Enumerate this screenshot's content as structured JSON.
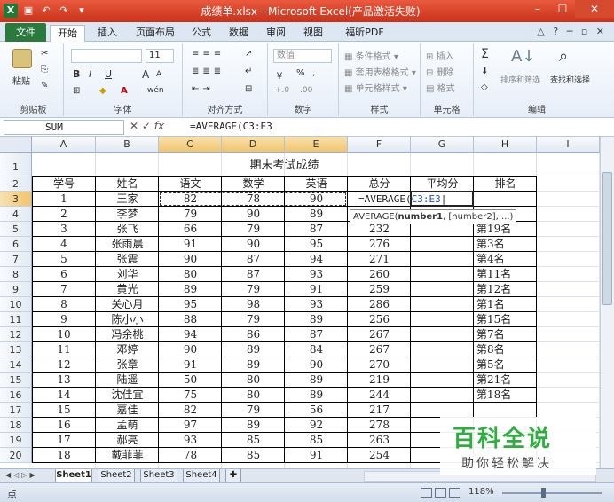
{
  "window": {
    "title": "成绩单.xlsx - Microsoft Excel(产品激活失败)",
    "min": "–",
    "max": "☐",
    "close": "✕"
  },
  "tabs": [
    "文件",
    "开始",
    "插入",
    "页面布局",
    "公式",
    "数据",
    "审阅",
    "视图",
    "福昕PDF"
  ],
  "tab_right": "△ ? ─ ▫ ✕",
  "ribbon": {
    "clipboard": {
      "label": "剪贴板",
      "paste": "粘贴"
    },
    "font": {
      "label": "字体",
      "size": "11",
      "bold": "B",
      "italic": "I",
      "underline": "U",
      "grow": "A",
      "shrink": "A",
      "wen": "wén"
    },
    "align": {
      "label": "对齐方式"
    },
    "number": {
      "label": "数字",
      "format": "数值",
      "percent": "%",
      "comma": ",",
      "inc": "+.0",
      "dec": ".00"
    },
    "styles": {
      "label": "样式",
      "cond": "条件格式",
      "table": "套用表格格式",
      "cell": "单元格样式"
    },
    "cells": {
      "label": "单元格",
      "insert": "插入",
      "delete": "删除",
      "format": "格式"
    },
    "edit": {
      "label": "编辑",
      "sigma": "Σ",
      "sort": "排序和筛选",
      "find": "查找和选择"
    }
  },
  "formula_bar": {
    "name": "SUM",
    "fx": "fx",
    "formula": "=AVERAGE(C3:E3"
  },
  "columns": [
    "A",
    "B",
    "C",
    "D",
    "E",
    "F",
    "G",
    "H",
    "I"
  ],
  "rows": [
    "1",
    "2",
    "3",
    "4",
    "5",
    "6",
    "7",
    "8",
    "9",
    "10",
    "11",
    "12",
    "13",
    "14",
    "15",
    "16",
    "17",
    "18",
    "19",
    "20"
  ],
  "sheet": {
    "title": "期末考试成绩",
    "headers": [
      "学号",
      "姓名",
      "语文",
      "数学",
      "英语",
      "总分",
      "平均分",
      "排名"
    ],
    "data": [
      [
        "1",
        "王家",
        "82",
        "78",
        "90",
        "",
        "",
        ""
      ],
      [
        "2",
        "李梦",
        "79",
        "90",
        "89",
        "",
        "",
        ""
      ],
      [
        "3",
        "张飞",
        "66",
        "79",
        "87",
        "232",
        "",
        "第19名"
      ],
      [
        "4",
        "张雨晨",
        "91",
        "90",
        "95",
        "276",
        "",
        "第3名"
      ],
      [
        "5",
        "张震",
        "90",
        "87",
        "94",
        "271",
        "",
        "第4名"
      ],
      [
        "6",
        "刘华",
        "80",
        "87",
        "93",
        "260",
        "",
        "第11名"
      ],
      [
        "7",
        "黄光",
        "89",
        "79",
        "91",
        "259",
        "",
        "第12名"
      ],
      [
        "8",
        "关心月",
        "95",
        "98",
        "93",
        "286",
        "",
        "第1名"
      ],
      [
        "9",
        "陈小小",
        "88",
        "79",
        "89",
        "256",
        "",
        "第15名"
      ],
      [
        "10",
        "冯余桃",
        "94",
        "86",
        "87",
        "267",
        "",
        "第7名"
      ],
      [
        "11",
        "邓婷",
        "90",
        "89",
        "84",
        "267",
        "",
        "第8名"
      ],
      [
        "12",
        "张章",
        "91",
        "89",
        "90",
        "270",
        "",
        "第5名"
      ],
      [
        "13",
        "陆遥",
        "50",
        "80",
        "89",
        "219",
        "",
        "第21名"
      ],
      [
        "14",
        "沈佳宜",
        "75",
        "80",
        "89",
        "244",
        "",
        "第18名"
      ],
      [
        "15",
        "嘉佳",
        "82",
        "79",
        "56",
        "217",
        "",
        ""
      ],
      [
        "16",
        "孟萌",
        "97",
        "89",
        "92",
        "278",
        "",
        ""
      ],
      [
        "17",
        "郝亮",
        "93",
        "85",
        "85",
        "263",
        "",
        ""
      ],
      [
        "18",
        "戴菲菲",
        "78",
        "85",
        "91",
        "254",
        "",
        ""
      ]
    ],
    "editing_text": "=AVERAGE(",
    "editing_ref": "C3:E3",
    "tooltip_fn": "AVERAGE(",
    "tooltip_arg1": "number1",
    "tooltip_rest": ", [number2], ...)"
  },
  "sheet_tabs": [
    "Sheet1",
    "Sheet2",
    "Sheet3",
    "Sheet4"
  ],
  "status": {
    "mode": "点",
    "zoom": "118%",
    "zoom_minus": "−",
    "zoom_plus": "+"
  },
  "watermark": {
    "title": "百科全说",
    "subtitle": "助你轻松解决"
  },
  "colors": {
    "title_bar": "#d2452a",
    "file_tab": "#2a7a3e",
    "selection_header": "#f3c46c",
    "watermark": "#2fae3f"
  }
}
